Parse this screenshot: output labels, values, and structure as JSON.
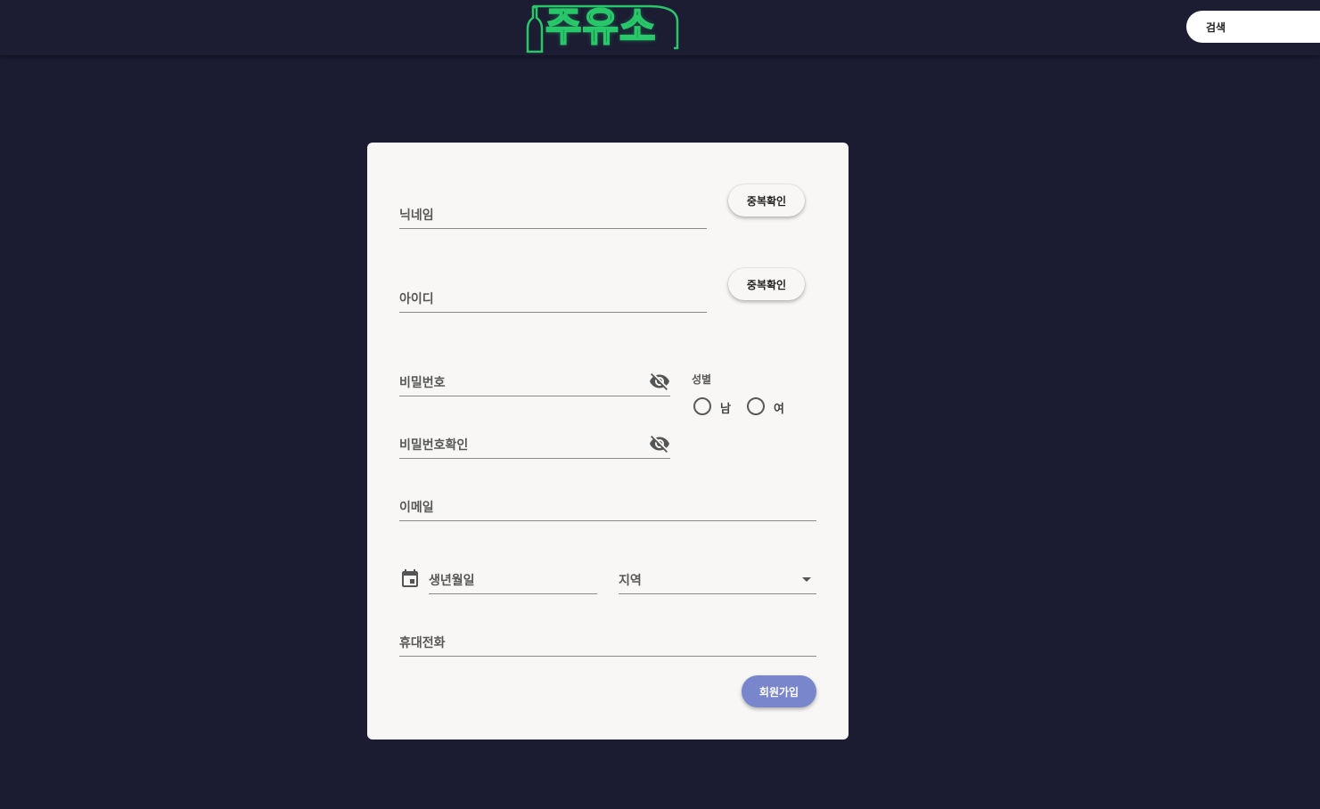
{
  "header": {
    "logo_text": "주유소",
    "search_placeholder": "검색"
  },
  "form": {
    "nickname_label": "닉네임",
    "nickname_check_button": "중복확인",
    "id_label": "아이디",
    "id_check_button": "중복확인",
    "password_label": "비밀번호",
    "password_confirm_label": "비밀번호확인",
    "gender_label": "성별",
    "gender_options": [
      "남",
      "여"
    ],
    "email_label": "이메일",
    "birthdate_label": "생년월일",
    "region_label": "지역",
    "phone_label": "휴대전화",
    "submit_button": "회원가입"
  },
  "colors": {
    "background": "#1b1b31",
    "card": "#f8f7f5",
    "logo_neon": "#27c76a",
    "submit_button": "#7986cb"
  }
}
